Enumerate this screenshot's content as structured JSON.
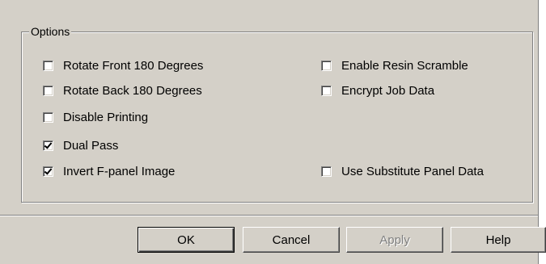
{
  "options_group": {
    "title": "Options"
  },
  "checkboxes": {
    "rotate_front": {
      "label": "Rotate Front 180 Degrees",
      "checked": false
    },
    "rotate_back": {
      "label": "Rotate Back 180 Degrees",
      "checked": false
    },
    "disable_printing": {
      "label": "Disable Printing",
      "checked": false
    },
    "dual_pass": {
      "label": "Dual Pass",
      "checked": true
    },
    "invert_fpanel": {
      "label": "Invert F-panel Image",
      "checked": true
    },
    "enable_resin_scramble": {
      "label": "Enable Resin Scramble",
      "checked": false
    },
    "encrypt_job_data": {
      "label": "Encrypt Job Data",
      "checked": false
    },
    "use_substitute_panel": {
      "label": "Use Substitute Panel Data",
      "checked": false
    }
  },
  "buttons": {
    "ok": "OK",
    "cancel": "Cancel",
    "apply": "Apply",
    "help": "Help"
  },
  "colors": {
    "dialog_face": "#d4d0c8",
    "shadow": "#808080",
    "highlight": "#ffffff",
    "disabled_text": "#808080"
  }
}
